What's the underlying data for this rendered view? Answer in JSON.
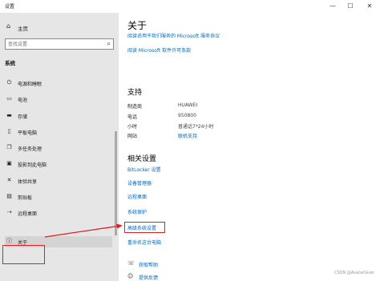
{
  "window": {
    "title": "设置",
    "minimize_glyph": "—",
    "maximize_glyph": "☐",
    "close_glyph": "✕"
  },
  "sidebar": {
    "home_label": "主页",
    "home_icon": "home-icon",
    "search_placeholder": "查找设置",
    "search_icon": "search-icon",
    "section_label": "系统",
    "items": [
      {
        "label": "电源和睡眠",
        "icon": "power-icon",
        "glyph": "⏻"
      },
      {
        "label": "电池",
        "icon": "battery-icon",
        "glyph": "▭"
      },
      {
        "label": "存储",
        "icon": "storage-icon",
        "glyph": "▬"
      },
      {
        "label": "平板电脑",
        "icon": "tablet-icon",
        "glyph": "▯"
      },
      {
        "label": "多任务处理",
        "icon": "multitask-icon",
        "glyph": "❐"
      },
      {
        "label": "投影到此电脑",
        "icon": "project-icon",
        "glyph": "▣"
      },
      {
        "label": "体验共享",
        "icon": "share-icon",
        "glyph": "✕"
      },
      {
        "label": "剪贴板",
        "icon": "clipboard-icon",
        "glyph": "▤"
      },
      {
        "label": "远程桌面",
        "icon": "remote-icon",
        "glyph": "⇢"
      },
      {
        "label": "关于",
        "icon": "info-icon",
        "glyph": "ⓘ"
      }
    ]
  },
  "main": {
    "title": "关于",
    "top_link_clipped": "阅读适用于我们服务的 Microsoft 服务协议",
    "license_link": "阅读 Microsoft 软件许可条款",
    "support": {
      "heading": "支持",
      "rows": [
        {
          "key": "制造商",
          "value": "HUAWEI"
        },
        {
          "key": "电话",
          "value": "950800"
        },
        {
          "key": "小时",
          "value": "普通话7*24小时"
        },
        {
          "key": "网站",
          "value": "联机支持"
        }
      ]
    },
    "related": {
      "heading": "相关设置",
      "links": [
        "BitLocker 设置",
        "设备管理器",
        "远程桌面",
        "系统保护",
        "高级系统设置",
        "重命名这台电脑"
      ]
    },
    "help": [
      {
        "label": "获取帮助",
        "icon": "help-icon",
        "glyph": "☏"
      },
      {
        "label": "提供反馈",
        "icon": "feedback-icon",
        "glyph": "☺"
      }
    ]
  },
  "annotation": {
    "color": "#e02020"
  },
  "watermark": "CSDN @AvatarGiser"
}
